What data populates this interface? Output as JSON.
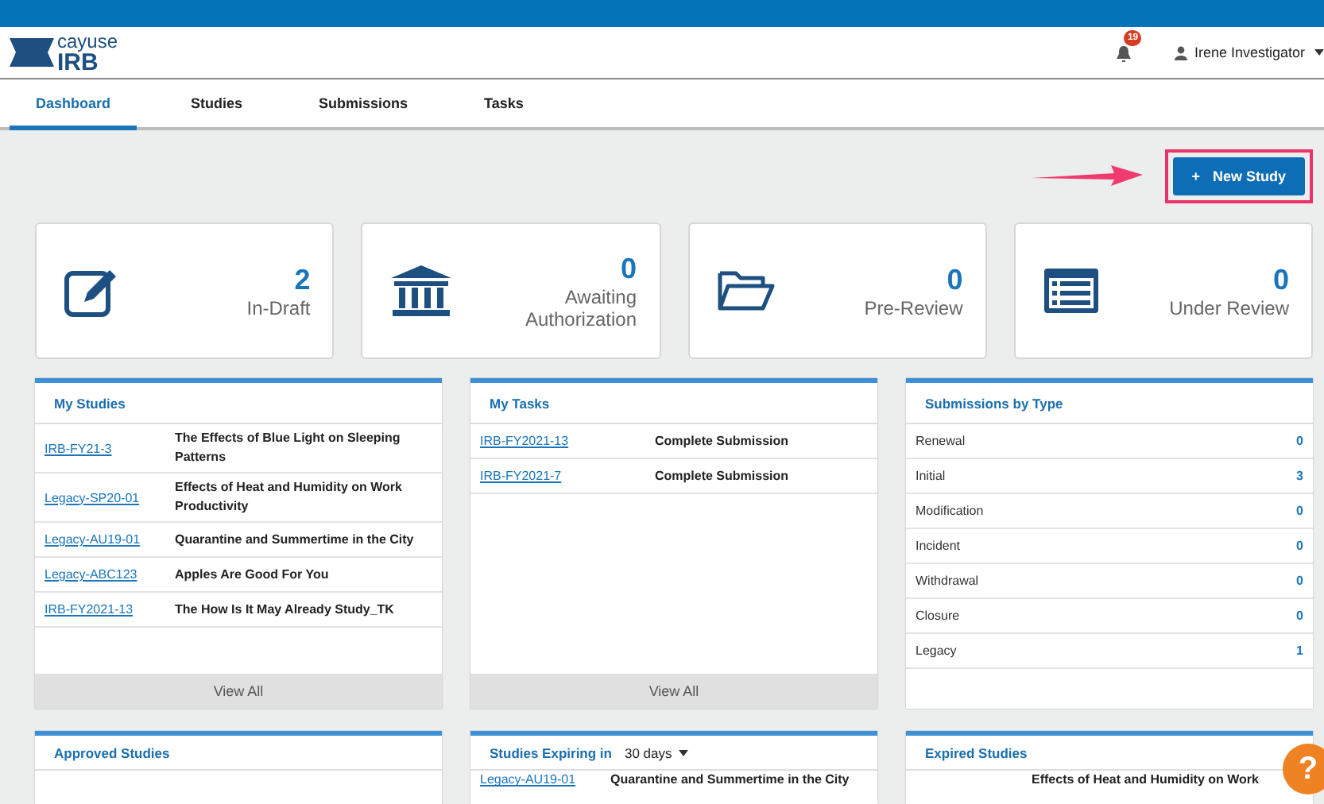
{
  "logo": {
    "top": "cayuse",
    "bottom": "IRB"
  },
  "notifications": {
    "count": "19"
  },
  "user": {
    "name": "Irene Investigator"
  },
  "tabs": [
    {
      "label": "Dashboard",
      "selected": true
    },
    {
      "label": "Studies",
      "selected": false
    },
    {
      "label": "Submissions",
      "selected": false
    },
    {
      "label": "Tasks",
      "selected": false
    }
  ],
  "new_study_button": {
    "icon": "+",
    "label": "New Study",
    "highlighted": true
  },
  "stats": [
    {
      "kind": "draft",
      "count": "2",
      "label": "In-Draft"
    },
    {
      "kind": "authorization",
      "count": "0",
      "label": "Awaiting Authorization"
    },
    {
      "kind": "prereview",
      "count": "0",
      "label": "Pre-Review"
    },
    {
      "kind": "review",
      "count": "0",
      "label": "Under Review"
    }
  ],
  "my_studies": {
    "title": "My Studies",
    "rows": [
      {
        "id": "IRB-FY21-3",
        "title": "The Effects of Blue Light on Sleeping Patterns"
      },
      {
        "id": "Legacy-SP20-01",
        "title": "Effects of Heat and Humidity on Work Productivity"
      },
      {
        "id": "Legacy-AU19-01",
        "title": "Quarantine and Summertime in the City"
      },
      {
        "id": "Legacy-ABC123",
        "title": "Apples Are Good For You"
      },
      {
        "id": "IRB-FY2021-13",
        "title": "The How Is It May Already Study_TK"
      }
    ],
    "footer": "View All"
  },
  "my_tasks": {
    "title": "My Tasks",
    "rows": [
      {
        "id": "IRB-FY2021-13",
        "task": "Complete Submission"
      },
      {
        "id": "IRB-FY2021-7",
        "task": "Complete Submission"
      }
    ],
    "footer": "View All"
  },
  "submissions_by_type": {
    "title": "Submissions by Type",
    "rows": [
      {
        "type": "Renewal",
        "count": "0"
      },
      {
        "type": "Initial",
        "count": "3"
      },
      {
        "type": "Modification",
        "count": "0"
      },
      {
        "type": "Incident",
        "count": "0"
      },
      {
        "type": "Withdrawal",
        "count": "0"
      },
      {
        "type": "Closure",
        "count": "0"
      },
      {
        "type": "Legacy",
        "count": "1"
      }
    ]
  },
  "approved_studies": {
    "title": "Approved Studies"
  },
  "studies_expiring": {
    "title": "Studies Expiring in",
    "period": "30 days",
    "rows": [
      {
        "id": "Legacy-AU19-01",
        "title": "Quarantine and Summertime in the City"
      }
    ]
  },
  "expired_studies": {
    "title": "Expired Studies",
    "rows": [
      {
        "title": "Effects of Heat and Humidity on Work"
      }
    ]
  },
  "help_button": {
    "label": "?"
  }
}
